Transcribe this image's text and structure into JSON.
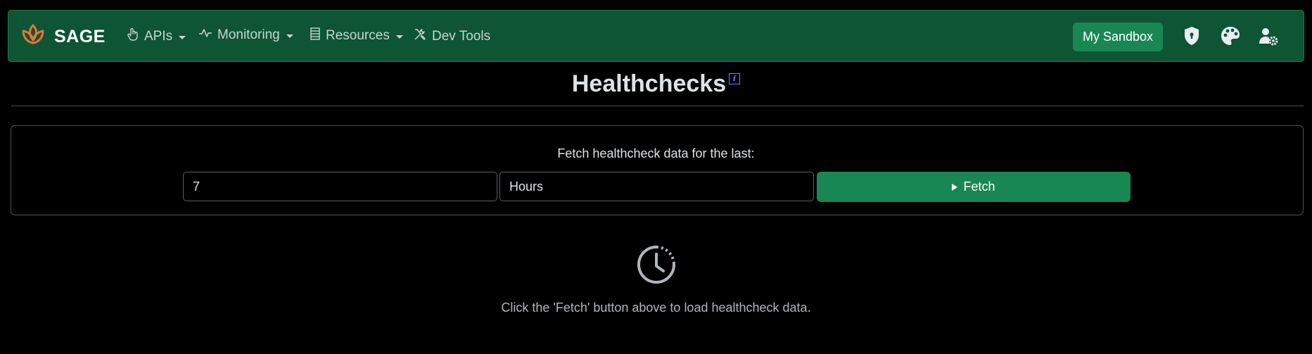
{
  "brand": {
    "name": "SAGE",
    "icon": "lotus-icon",
    "accent": "#e8733a"
  },
  "nav": {
    "items": [
      {
        "label": "APIs",
        "icon": "hand-pointer-icon",
        "dropdown": true
      },
      {
        "label": "Monitoring",
        "icon": "activity-icon",
        "dropdown": true
      },
      {
        "label": "Resources",
        "icon": "list-icon",
        "dropdown": true
      },
      {
        "label": "Dev Tools",
        "icon": "tools-icon",
        "dropdown": false
      }
    ],
    "sandbox_label": "My Sandbox",
    "right_icons": [
      "shield-lock-icon",
      "palette-icon",
      "user-gear-icon"
    ]
  },
  "page": {
    "title": "Healthchecks",
    "info_icon_text": "i"
  },
  "form": {
    "label": "Fetch healthcheck data for the last:",
    "amount_value": "7",
    "unit_value": "Hours",
    "fetch_label": "Fetch"
  },
  "empty_state": {
    "icon": "clock-history-icon",
    "message": "Click the 'Fetch' button above to load healthcheck data."
  },
  "colors": {
    "navbar_bg": "#0d5535",
    "primary_button": "#198754",
    "page_bg": "#000000"
  }
}
